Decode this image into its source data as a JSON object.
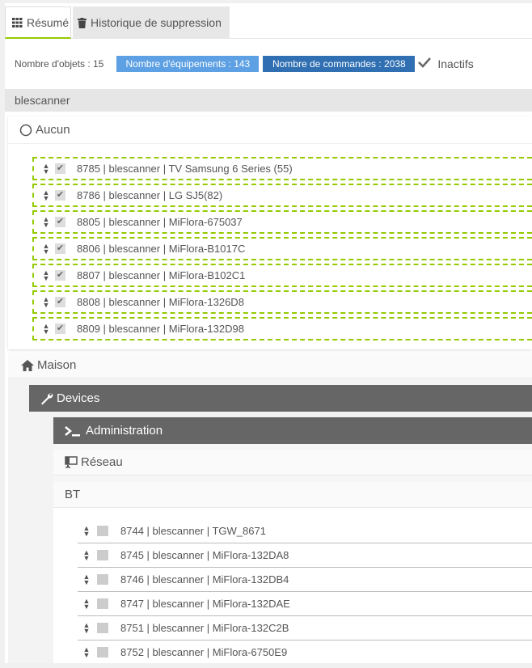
{
  "tabs": [
    {
      "label": "Résumé",
      "icon": "grid-icon"
    },
    {
      "label": "Historique de suppression",
      "icon": "trash-icon"
    }
  ],
  "summary": {
    "objects_label": "Nombre d'objets : 15",
    "equipments_label": "Nombre d'équipements : 143",
    "commands_label": "Nombre de commandes : 2038",
    "inactive_label": "Inactifs",
    "colors": {
      "equipments": "#5da0e3",
      "commands": "#2f6fb2",
      "accent": "#94ca02"
    }
  },
  "object_name": "blescanner",
  "group_aucun": {
    "title": "Aucun",
    "items": [
      {
        "text": "8785 | blescanner | TV Samsung 6 Series (55)"
      },
      {
        "text": "8786 | blescanner | LG SJ5(82)"
      },
      {
        "text": "8805 | blescanner | MiFlora-675037"
      },
      {
        "text": "8806 | blescanner | MiFlora-B1017C"
      },
      {
        "text": "8807 | blescanner | MiFlora-B102C1"
      },
      {
        "text": "8808 | blescanner | MiFlora-1326D8"
      },
      {
        "text": "8809 | blescanner | MiFlora-132D98"
      }
    ]
  },
  "group_maison": {
    "title": "Maison",
    "devices": {
      "title": "Devices",
      "administration": {
        "title": "Administration"
      },
      "reseau": {
        "title": "Réseau"
      },
      "bt": {
        "title": "BT",
        "items": [
          {
            "text": "8744 | blescanner | TGW_8671"
          },
          {
            "text": "8745 | blescanner | MiFlora-132DA8"
          },
          {
            "text": "8746 | blescanner | MiFlora-132DB4"
          },
          {
            "text": "8747 | blescanner | MiFlora-132DAE"
          },
          {
            "text": "8751 | blescanner | MiFlora-132C2B"
          },
          {
            "text": "8752 | blescanner | MiFlora-6750E9"
          }
        ]
      }
    }
  }
}
